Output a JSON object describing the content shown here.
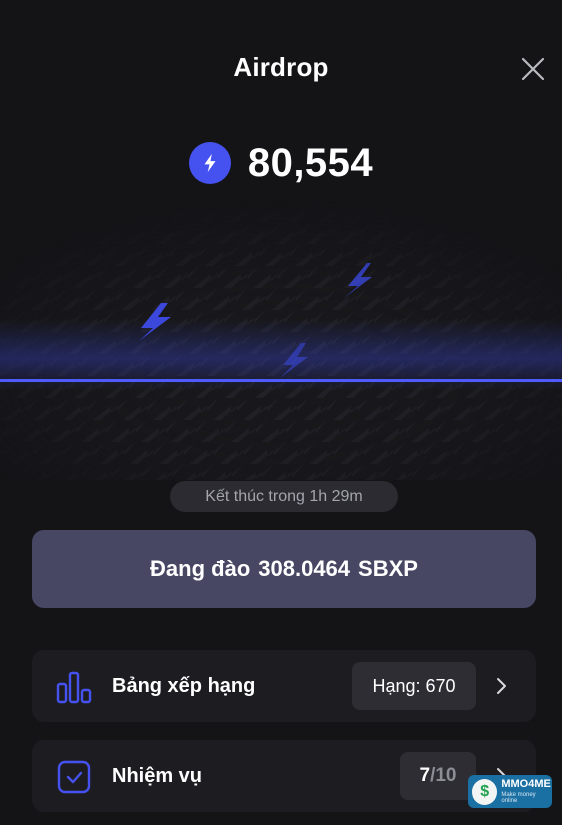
{
  "header": {
    "title": "Airdrop",
    "close_icon": "close-icon"
  },
  "balance": {
    "icon": "lightning-coin-icon",
    "value": "80,554"
  },
  "timer": {
    "text": "Kết thúc trong 1h 29m"
  },
  "mining_button": {
    "label": "Đang đào",
    "amount": "308.0464",
    "unit": "SBXP"
  },
  "cards": {
    "ranking": {
      "icon": "bar-chart-icon",
      "label": "Bảng xếp hạng",
      "badge": "Hạng: 670"
    },
    "tasks": {
      "icon": "checkbox-icon",
      "label": "Nhiệm vụ",
      "done": "7",
      "total": "/10"
    }
  },
  "watermark": {
    "logo_glyph": "$",
    "name": "MMO4ME",
    "tagline": "Make money online"
  },
  "colors": {
    "accent": "#4552f0",
    "background": "#141417",
    "card": "#1d1d21",
    "mining_button": "#474764"
  }
}
